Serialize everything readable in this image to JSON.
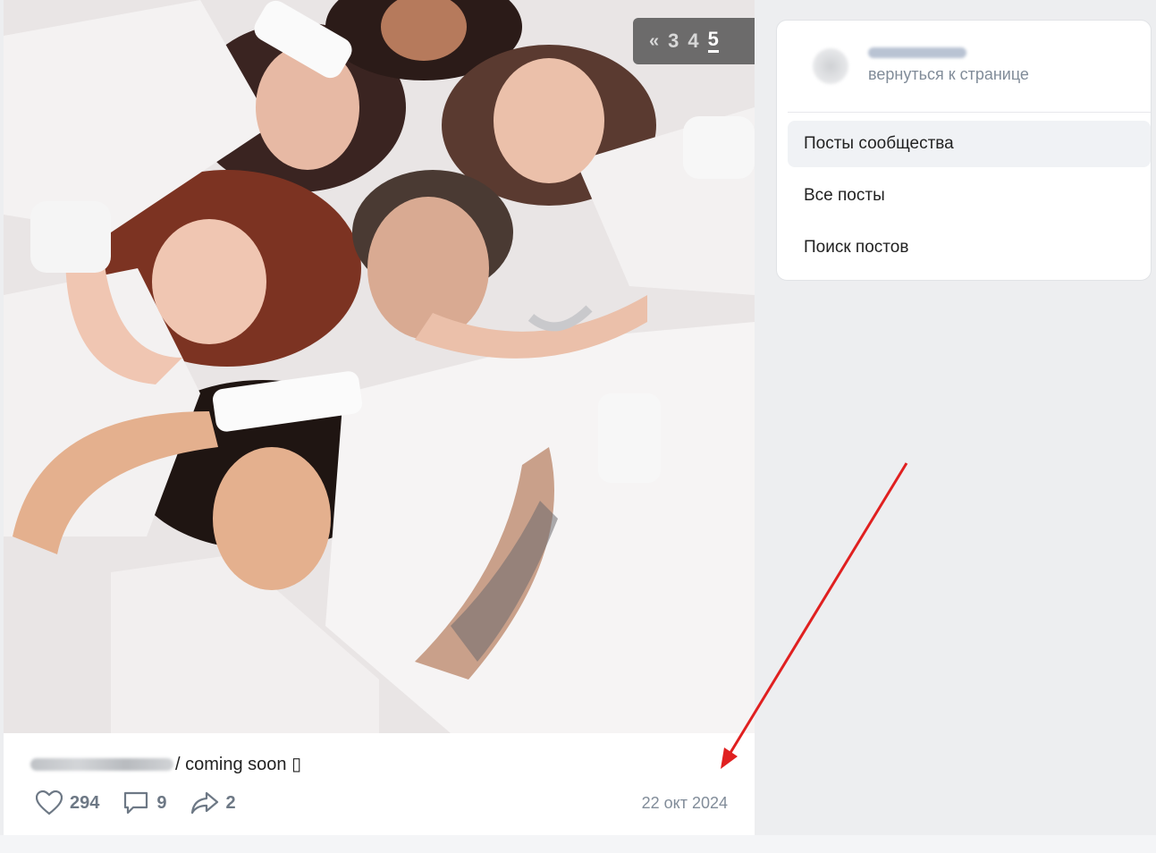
{
  "pager": {
    "prev": "«",
    "pages": [
      "3",
      "4",
      "5"
    ],
    "active": "5"
  },
  "post": {
    "text": "/ coming soon ▯",
    "likes": "294",
    "comments": "9",
    "shares": "2",
    "date": "22 окт 2024"
  },
  "sidebar": {
    "back_label": "вернуться к странице",
    "items": [
      {
        "label": "Посты сообщества",
        "active": true
      },
      {
        "label": "Все посты"
      },
      {
        "label": "Поиск постов"
      }
    ]
  },
  "colors": {
    "accent": "#e02020",
    "text_secondary": "#818c99",
    "bg": "#edeef0"
  },
  "icons": [
    "heart-icon",
    "comment-icon",
    "share-icon"
  ]
}
